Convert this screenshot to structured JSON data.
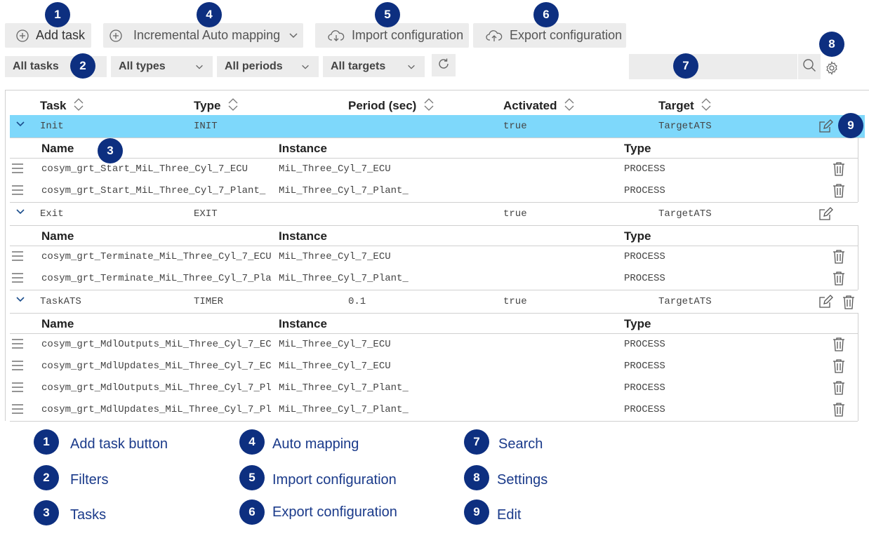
{
  "toolbar": {
    "add_task": "Add task",
    "incremental_auto_mapping": "Incremental Auto mapping",
    "import_configuration": "Import configuration",
    "export_configuration": "Export configuration"
  },
  "filters": {
    "tasks": "All tasks",
    "types": "All types",
    "periods": "All periods",
    "targets": "All targets"
  },
  "search": {
    "placeholder": ""
  },
  "table": {
    "headers": {
      "task": "Task",
      "type": "Type",
      "period": "Period (sec)",
      "activated": "Activated",
      "target": "Target"
    },
    "sub_headers": {
      "name": "Name",
      "instance": "Instance",
      "type": "Type"
    },
    "tasks": [
      {
        "task": "Init",
        "type": "INIT",
        "period": "",
        "activated": "true",
        "target": "TargetATS",
        "items": [
          {
            "name": "cosym_grt_Start_MiL_Three_Cyl_7_ECU",
            "instance": "MiL_Three_Cyl_7_ECU",
            "type": "PROCESS"
          },
          {
            "name": "cosym_grt_Start_MiL_Three_Cyl_7_Plant_",
            "instance": "MiL_Three_Cyl_7_Plant_",
            "type": "PROCESS"
          }
        ]
      },
      {
        "task": "Exit",
        "type": "EXIT",
        "period": "",
        "activated": "true",
        "target": "TargetATS",
        "items": [
          {
            "name": "cosym_grt_Terminate_MiL_Three_Cyl_7_ECU",
            "instance": "MiL_Three_Cyl_7_ECU",
            "type": "PROCESS"
          },
          {
            "name": "cosym_grt_Terminate_MiL_Three_Cyl_7_Pla",
            "instance": "MiL_Three_Cyl_7_Plant_",
            "type": "PROCESS"
          }
        ]
      },
      {
        "task": "TaskATS",
        "type": "TIMER",
        "period": "0.1",
        "activated": "true",
        "target": "TargetATS",
        "items": [
          {
            "name": "cosym_grt_MdlOutputs_MiL_Three_Cyl_7_EC",
            "instance": "MiL_Three_Cyl_7_ECU",
            "type": "PROCESS"
          },
          {
            "name": "cosym_grt_MdlUpdates_MiL_Three_Cyl_7_EC",
            "instance": "MiL_Three_Cyl_7_ECU",
            "type": "PROCESS"
          },
          {
            "name": "cosym_grt_MdlOutputs_MiL_Three_Cyl_7_Pl",
            "instance": "MiL_Three_Cyl_7_Plant_",
            "type": "PROCESS"
          },
          {
            "name": "cosym_grt_MdlUpdates_MiL_Three_Cyl_7_Pl",
            "instance": "MiL_Three_Cyl_7_Plant_",
            "type": "PROCESS"
          }
        ]
      }
    ]
  },
  "callouts": [
    "1",
    "2",
    "3",
    "4",
    "5",
    "6",
    "7",
    "8",
    "9"
  ],
  "legend": [
    {
      "num": "1",
      "label": "Add task button"
    },
    {
      "num": "2",
      "label": "Filters"
    },
    {
      "num": "3",
      "label": "Tasks"
    },
    {
      "num": "4",
      "label": "Auto mapping"
    },
    {
      "num": "5",
      "label": "Import configuration"
    },
    {
      "num": "6",
      "label": "Export configuration"
    },
    {
      "num": "7",
      "label": "Search"
    },
    {
      "num": "8",
      "label": "Settings"
    },
    {
      "num": "9",
      "label": "Edit"
    }
  ],
  "colors": {
    "selected_row": "#7ed8fb",
    "badge": "#0d2f80",
    "legend_text": "#1a3a8a"
  }
}
